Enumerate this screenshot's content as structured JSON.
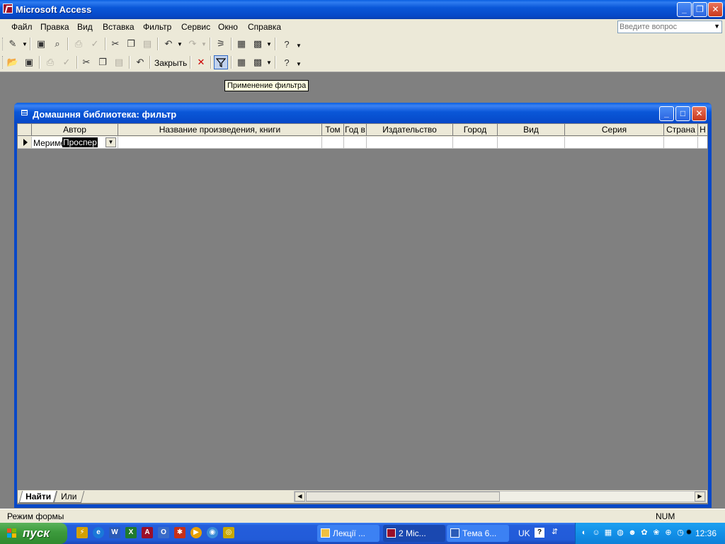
{
  "window": {
    "title": "Microsoft Access",
    "minimize": "_",
    "restore": "❐",
    "close": "✕"
  },
  "menu": {
    "items": [
      "Файл",
      "Правка",
      "Вид",
      "Вставка",
      "Фильтр",
      "Сервис",
      "Окно",
      "Справка"
    ],
    "ask_placeholder": "Введите вопрос"
  },
  "toolbar2": {
    "close_label": "Закрыть"
  },
  "tooltip": "Применение фильтра",
  "child": {
    "title": "Домашння библиотека: фильтр",
    "columns": [
      "Автор",
      "Название произведения, книги",
      "Том",
      "Год в",
      "Издательство",
      "Город",
      "Вид",
      "Серия",
      "Страна",
      "Н"
    ],
    "author_prefix": "Мериме",
    "author_selected": "Проспер",
    "tabs": [
      "Найти",
      "Или"
    ]
  },
  "status": {
    "mode": "Режим формы",
    "num": "NUM"
  },
  "taskbar": {
    "start": "пуск",
    "tasks": [
      "Лекції ...",
      "2 Mic...",
      "Тема 6..."
    ],
    "lang": "UK",
    "clock": "12:36"
  },
  "colors": {
    "title_blue": "#0648c8",
    "toolbar": "#ece9d8",
    "workspace": "#808080",
    "tooltip": "#ffffe1"
  }
}
